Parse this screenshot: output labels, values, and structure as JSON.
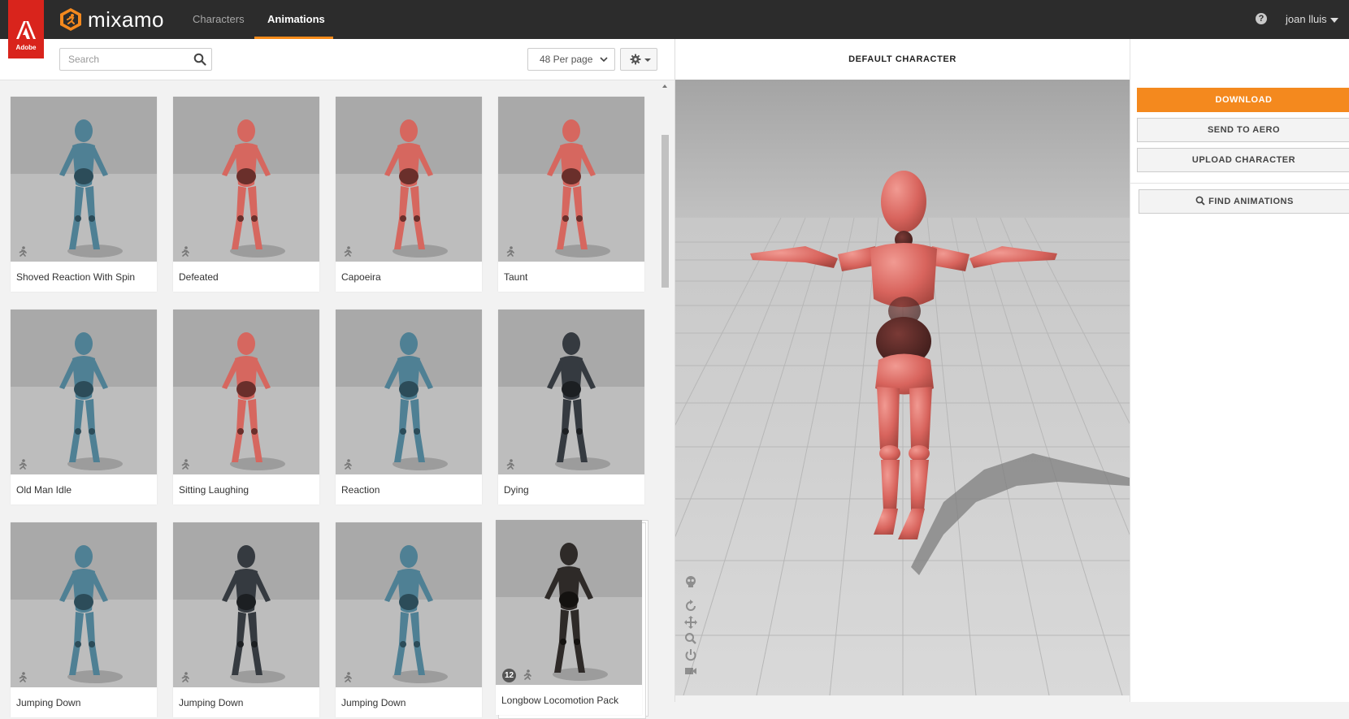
{
  "header": {
    "adobe_label": "Adobe",
    "logo_text": "mixamo",
    "tabs": [
      {
        "label": "Characters",
        "active": false
      },
      {
        "label": "Animations",
        "active": true
      }
    ],
    "help_glyph": "?",
    "user_name": "joan lluis",
    "accent_color": "#f4891e"
  },
  "toolbar": {
    "search_placeholder": "Search",
    "search_value": "",
    "per_page": "48 Per page"
  },
  "animations": [
    {
      "label": "Shoved Reaction With Spin",
      "character": "blue"
    },
    {
      "label": "Defeated",
      "character": "red"
    },
    {
      "label": "Capoeira",
      "character": "red"
    },
    {
      "label": "Taunt",
      "character": "red"
    },
    {
      "label": "Old Man Idle",
      "character": "blue"
    },
    {
      "label": "Sitting Laughing",
      "character": "red"
    },
    {
      "label": "Reaction",
      "character": "blue"
    },
    {
      "label": "Dying",
      "character": "soldier"
    },
    {
      "label": "Jumping Down",
      "character": "blue"
    },
    {
      "label": "Jumping Down",
      "character": "soldier"
    },
    {
      "label": "Jumping Down",
      "character": "blue"
    },
    {
      "label": "Longbow Locomotion Pack",
      "character": "archer",
      "pack_count": "12"
    }
  ],
  "viewport": {
    "title": "DEFAULT CHARACTER"
  },
  "actions": {
    "download": "DOWNLOAD",
    "send_to_aero": "SEND TO AERO",
    "upload_character": "UPLOAD CHARACTER",
    "find_animations": "FIND ANIMATIONS"
  }
}
